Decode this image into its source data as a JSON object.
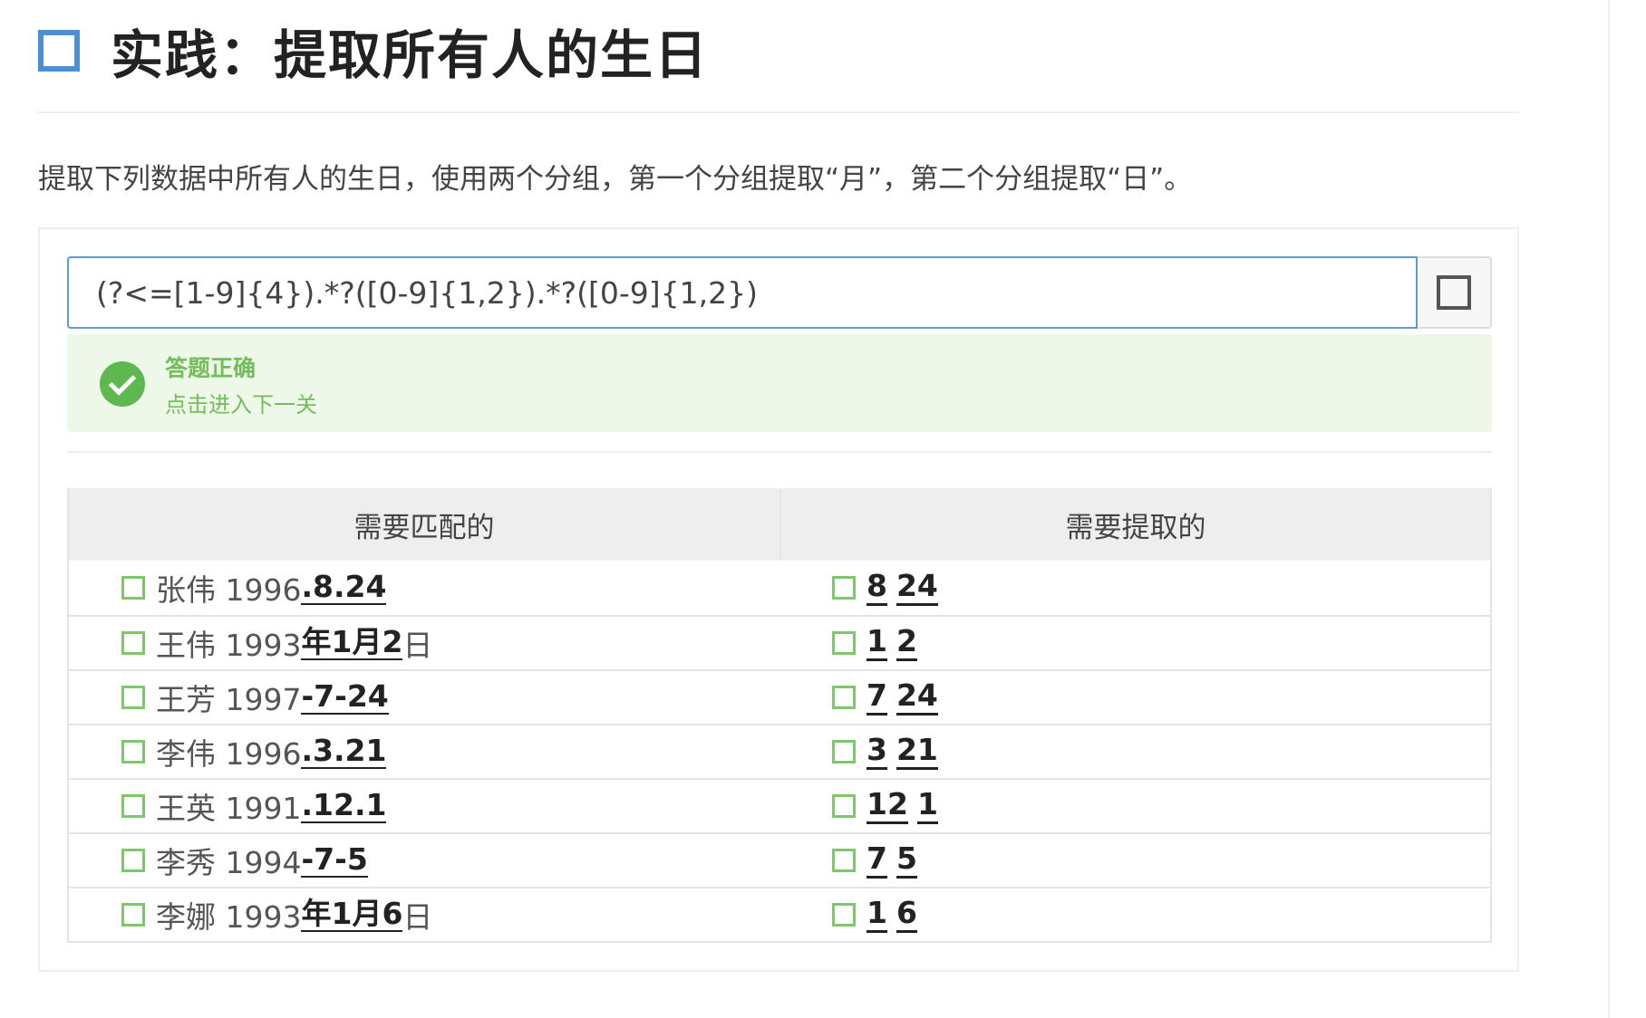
{
  "heading": {
    "title": "实践：提取所有人的生日"
  },
  "description": "提取下列数据中所有人的生日，使用两个分组，第一个分组提取“月”，第二个分组提取“日”。",
  "input": {
    "value": "(?<=[1-9]{4}).*?([0-9]{1,2}).*?([0-9]{1,2})"
  },
  "result": {
    "title": "答题正确",
    "link": "点击进入下一关"
  },
  "table": {
    "col_match": "需要匹配的",
    "col_extract": "需要提取的",
    "rows": [
      {
        "prefix": "张伟 1996",
        "highlight": ".8.24",
        "suffix": "",
        "g1": "8",
        "g2": "24"
      },
      {
        "prefix": "王伟 1993",
        "highlight": "年1月2",
        "suffix": "日",
        "g1": "1",
        "g2": "2"
      },
      {
        "prefix": "王芳 1997",
        "highlight": "-7-24",
        "suffix": "",
        "g1": "7",
        "g2": "24"
      },
      {
        "prefix": "李伟 1996",
        "highlight": ".3.21",
        "suffix": "",
        "g1": "3",
        "g2": "21"
      },
      {
        "prefix": "王英 1991",
        "highlight": ".12.1",
        "suffix": "",
        "g1": "12",
        "g2": "1"
      },
      {
        "prefix": "李秀 1994",
        "highlight": "-7-5",
        "suffix": "",
        "g1": "7",
        "g2": "5"
      },
      {
        "prefix": "李娜 1993",
        "highlight": "年1月6",
        "suffix": "日",
        "g1": "1",
        "g2": "6"
      }
    ]
  },
  "colors": {
    "accent": "#4a90d2",
    "success": "#5cb84f",
    "success_bg": "#eef8e8"
  }
}
